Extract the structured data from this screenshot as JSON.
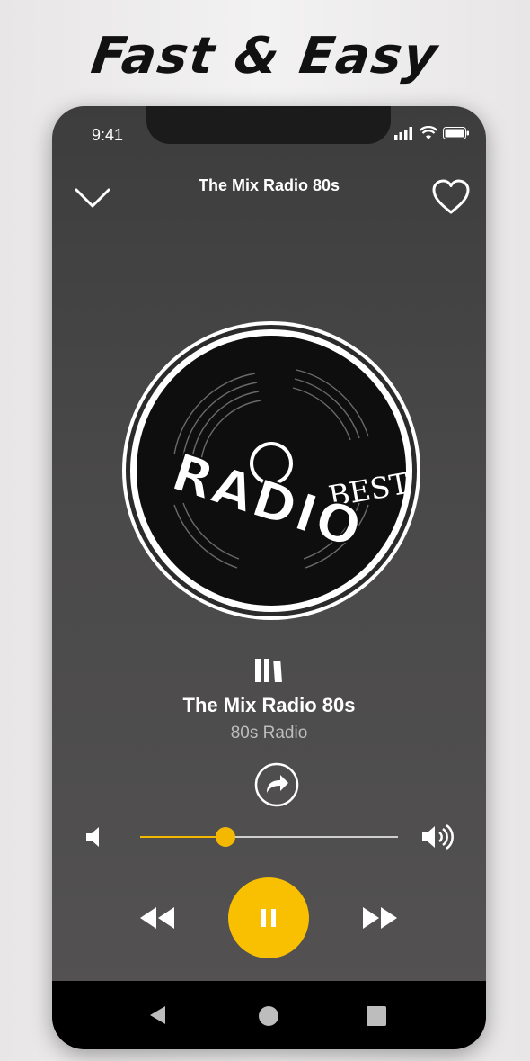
{
  "headline": "Fast & Easy",
  "status_bar": {
    "time": "9:41"
  },
  "header": {
    "title": "The Mix Radio 80s"
  },
  "artwork": {
    "word_best": "BEST",
    "word_radio": "RADIO"
  },
  "station": {
    "title": "The Mix Radio 80s",
    "subtitle": "80s Radio"
  },
  "volume": {
    "level": 0.33
  },
  "player": {
    "state": "playing"
  },
  "colors": {
    "accent": "#f8c000",
    "screen_bg": "#4a4949",
    "nav_bg": "#000000"
  }
}
